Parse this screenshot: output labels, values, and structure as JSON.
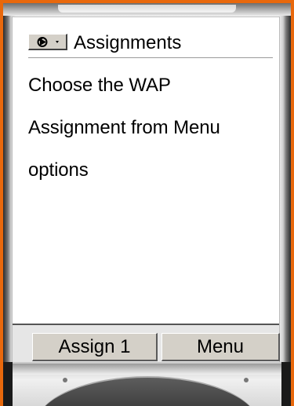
{
  "screen": {
    "title": "Assignments",
    "menu_icon": "options-menu-icon",
    "menu_dropdown_glyph": "·",
    "body_lines": [
      "Choose the WAP",
      "Assignment from Menu",
      "options"
    ]
  },
  "softkeys": {
    "left_label": "Assign 1",
    "right_label": "Menu"
  },
  "colors": {
    "outer_border": "#e8680c",
    "button_face": "#d4d0c8",
    "screen_bg": "#ffffff",
    "softkey_bar_bg": "#e6e6e6"
  }
}
